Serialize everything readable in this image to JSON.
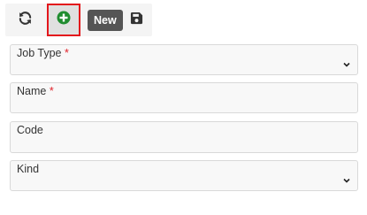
{
  "toolbar": {
    "buttons": [
      {
        "name": "refresh",
        "icon": "refresh-icon"
      },
      {
        "name": "add",
        "icon": "plus-circle-icon",
        "accent": "#1f8c2f",
        "highlight": "#e3161c"
      },
      {
        "name": "save",
        "icon": "floppy-disk-icon"
      }
    ],
    "tooltip": "New"
  },
  "form": {
    "fields": [
      {
        "label": "Job Type",
        "required_mark": "*",
        "type": "select",
        "value": ""
      },
      {
        "label": "Name",
        "required_mark": "*",
        "type": "text",
        "value": ""
      },
      {
        "label": "Code",
        "required_mark": "",
        "type": "text",
        "value": ""
      },
      {
        "label": "Kind",
        "required_mark": "",
        "type": "select",
        "value": ""
      }
    ]
  },
  "colors": {
    "required": "#e0222a",
    "tooltip_bg": "#555555",
    "field_bg": "#f8f8f8",
    "field_border": "#d9d9d9"
  }
}
